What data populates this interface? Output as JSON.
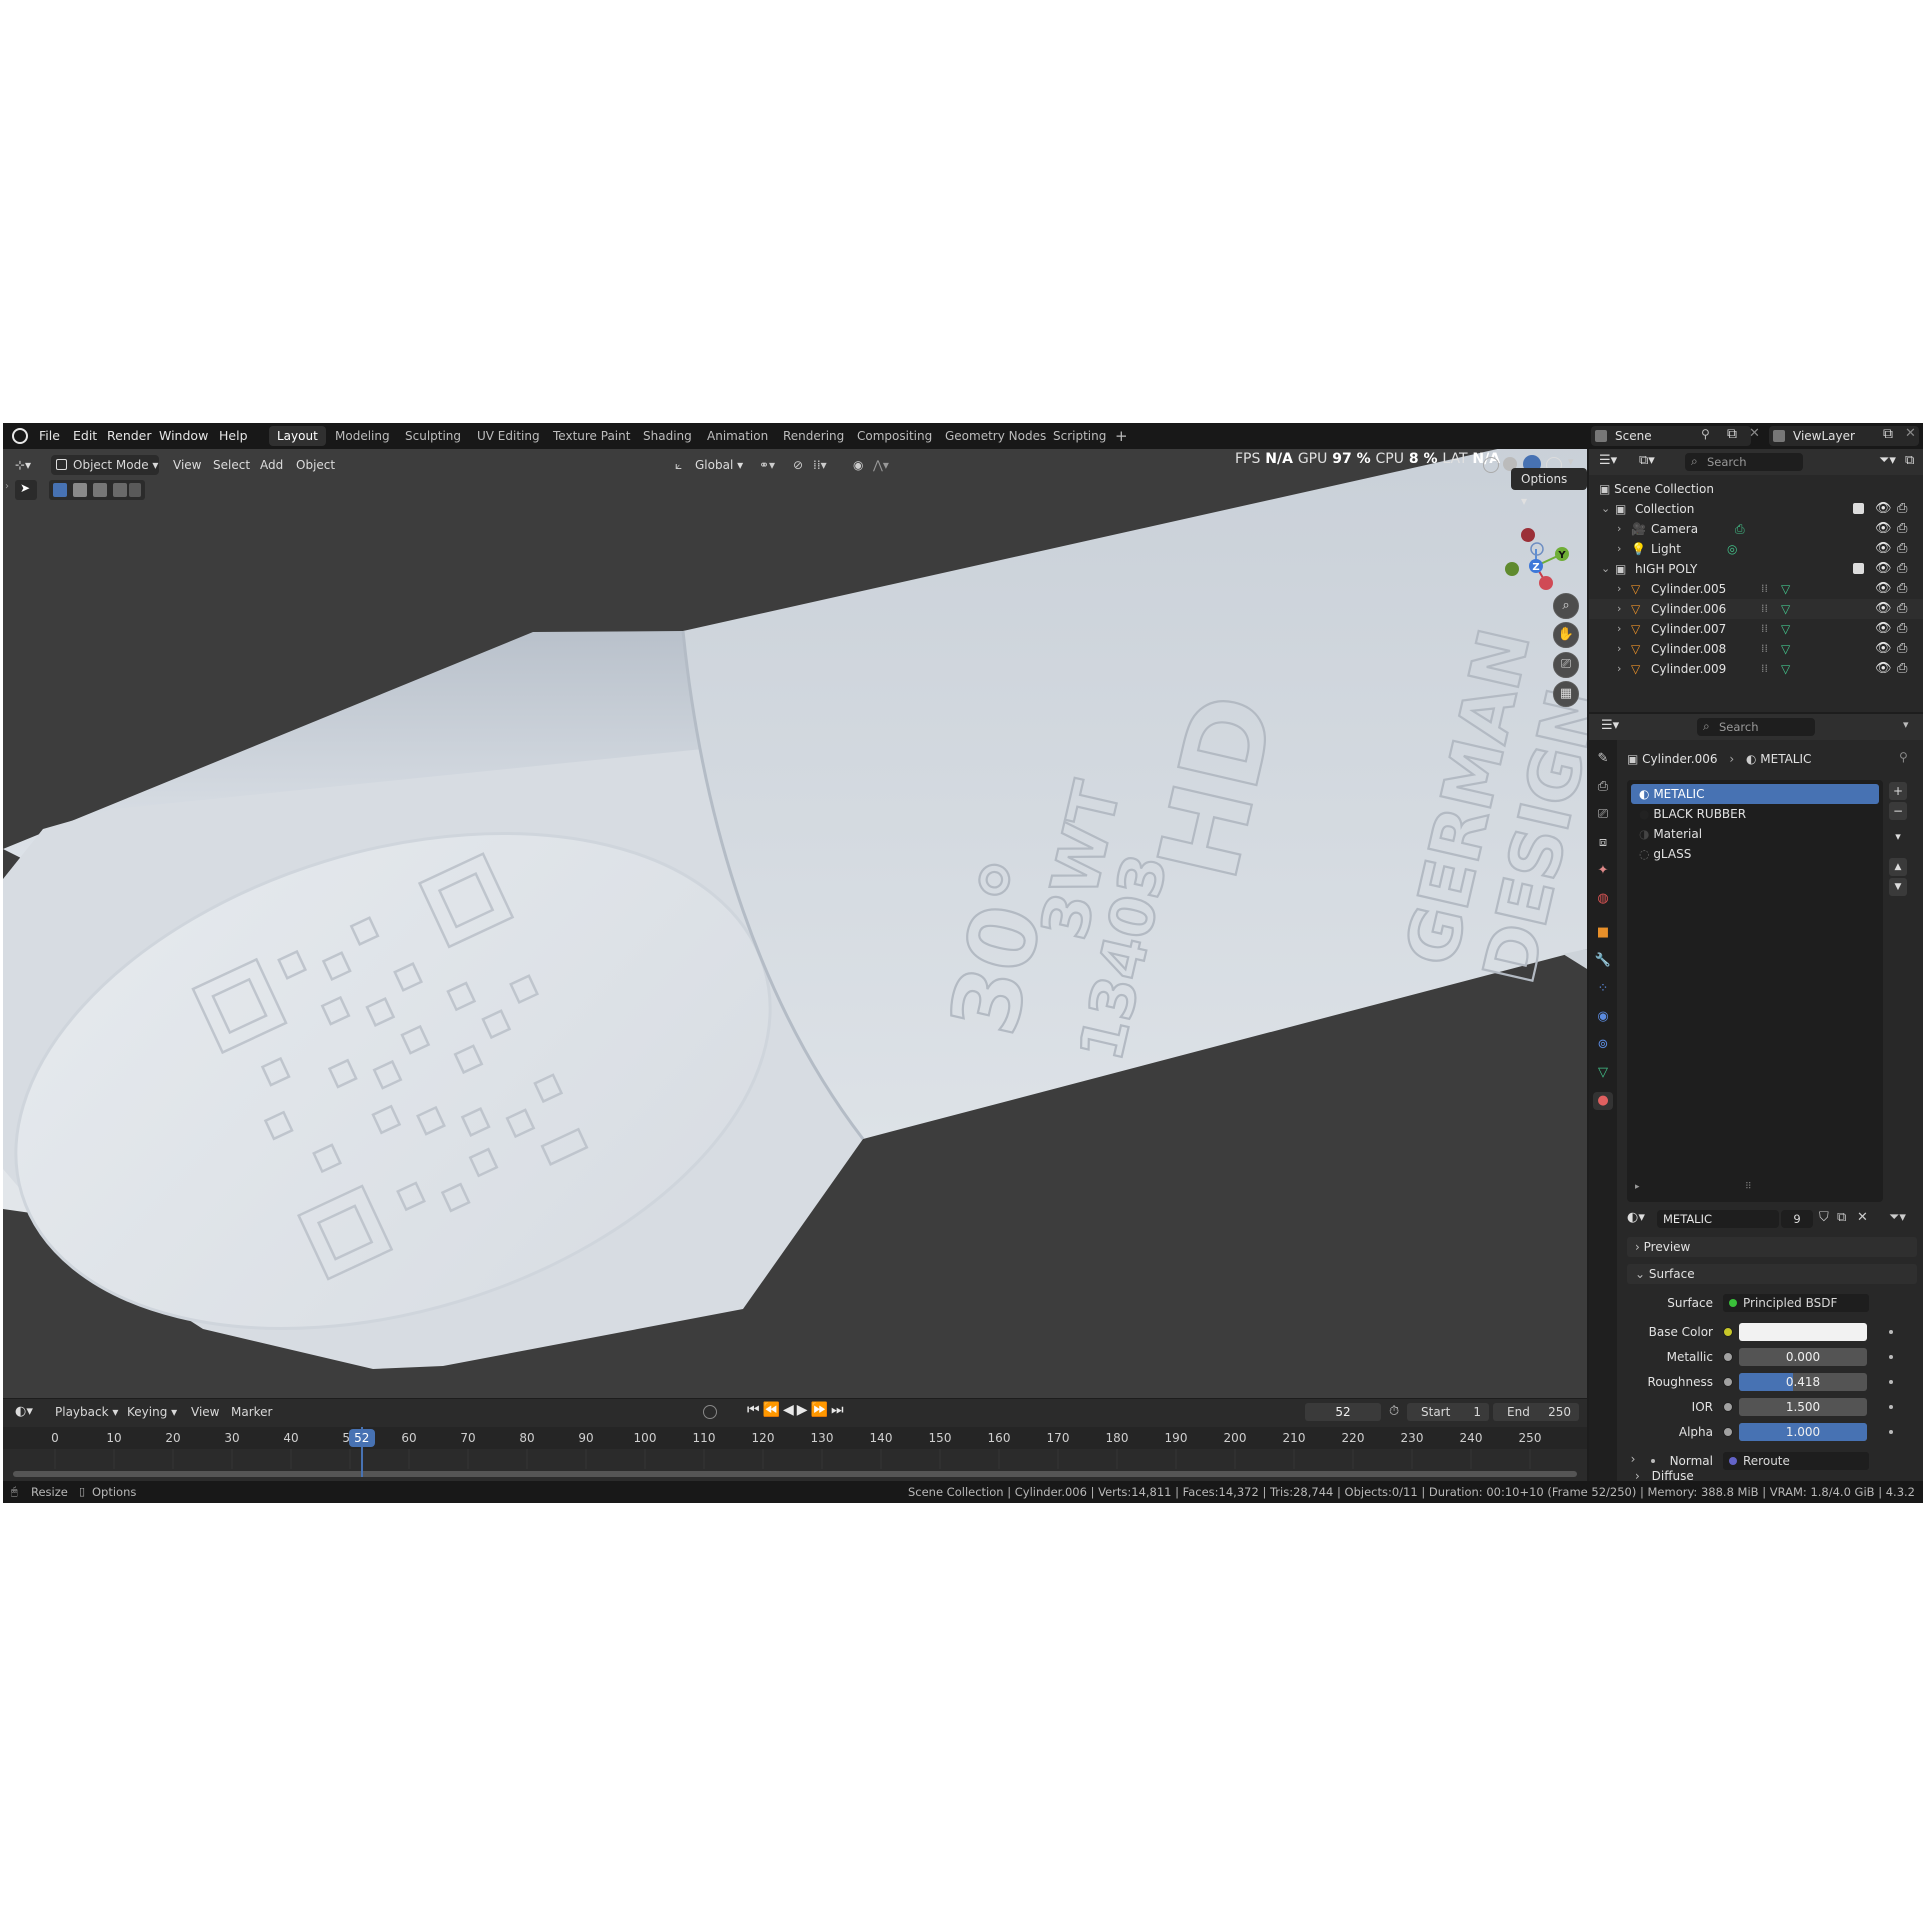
{
  "menus": [
    "File",
    "Edit",
    "Render",
    "Window",
    "Help"
  ],
  "workspaces": [
    "Layout",
    "Modeling",
    "Sculpting",
    "UV Editing",
    "Texture Paint",
    "Shading",
    "Animation",
    "Rendering",
    "Compositing",
    "Geometry Nodes",
    "Scripting",
    "+"
  ],
  "scene_name": "Scene",
  "view_layer": "ViewLayer",
  "viewport": {
    "mode": "Object Mode",
    "menu": [
      "View",
      "Select",
      "Add",
      "Object"
    ],
    "transform": "Global",
    "options": "Options",
    "hud": {
      "fps_label": "FPS",
      "fps_value": "N/A",
      "gpu_label": "GPU",
      "gpu_value": "97 %",
      "cpu_label": "CPU",
      "cpu_value": "8 %",
      "lat_label": "LAT",
      "lat_value": "N/A"
    },
    "gizmo": {
      "y": "Y",
      "z": "Z"
    },
    "engraving": {
      "line1": "30°",
      "line2": "3WT",
      "line3": "13403",
      "line4": "HD",
      "line5": "GERMAN",
      "line6": "DESIGN"
    }
  },
  "outliner": {
    "search_placeholder": "Search",
    "root": "Scene Collection",
    "items": [
      {
        "name": "Collection",
        "type": "collection"
      },
      {
        "name": "Camera",
        "type": "camera"
      },
      {
        "name": "Light",
        "type": "light"
      },
      {
        "name": "hIGH POLY",
        "type": "collection"
      },
      {
        "name": "Cylinder.005",
        "type": "mesh"
      },
      {
        "name": "Cylinder.006",
        "type": "mesh"
      },
      {
        "name": "Cylinder.007",
        "type": "mesh"
      },
      {
        "name": "Cylinder.008",
        "type": "mesh"
      },
      {
        "name": "Cylinder.009",
        "type": "mesh"
      }
    ]
  },
  "properties": {
    "search_placeholder": "Search",
    "breadcrumb_object": "Cylinder.006",
    "breadcrumb_material": "METALIC",
    "slots": [
      "METALIC",
      "BLACK RUBBER",
      "Material",
      "gLASS"
    ],
    "active_material": "METALIC",
    "user_count": "9",
    "sections": {
      "preview": "Preview",
      "surface": "Surface",
      "diffuse": "Diffuse"
    },
    "surface_label": "Surface",
    "surface_value": "Principled BSDF",
    "params": [
      {
        "label": "Base Color",
        "value": "",
        "socket": "#c7c729"
      },
      {
        "label": "Metallic",
        "value": "0.000",
        "fill": 0.0,
        "socket": "#a1a1a1"
      },
      {
        "label": "Roughness",
        "value": "0.418",
        "fill": 0.418,
        "socket": "#a1a1a1"
      },
      {
        "label": "IOR",
        "value": "1.500",
        "fill": 0.0,
        "socket": "#a1a1a1"
      },
      {
        "label": "Alpha",
        "value": "1.000",
        "fill": 1.0,
        "socket": "#a1a1a1"
      }
    ],
    "normal_label": "Normal",
    "normal_value": "Reroute"
  },
  "timeline": {
    "menus": [
      "Playback",
      "Keying",
      "View",
      "Marker"
    ],
    "current_frame": "52",
    "start_label": "Start",
    "start_value": "1",
    "end_label": "End",
    "end_value": "250",
    "ticks": [
      "0",
      "10",
      "20",
      "30",
      "40",
      "50",
      "60",
      "70",
      "80",
      "90",
      "100",
      "110",
      "120",
      "130",
      "140",
      "150",
      "160",
      "170",
      "180",
      "190",
      "200",
      "210",
      "220",
      "230",
      "240",
      "250"
    ]
  },
  "statusbar": {
    "left1": "Resize",
    "left2": "Options",
    "right": "Scene Collection | Cylinder.006 | Verts:14,811 | Faces:14,372 | Tris:28,744 | Objects:0/11 | Duration: 00:10+10 (Frame 52/250) | Memory: 388.8 MiB | VRAM: 1.8/4.0 GiB | 4.3.2"
  },
  "colors": {
    "accent": "#4772b3",
    "background": "#3d3d3d",
    "panel": "#282828",
    "model": "#dfe4ea"
  }
}
